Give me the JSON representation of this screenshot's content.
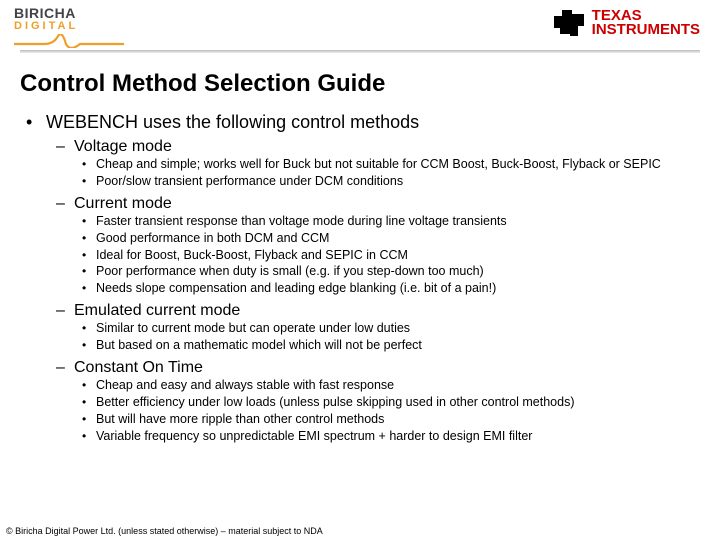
{
  "branding": {
    "left_top": "BIRICHA",
    "left_bottom": "DIGITAL",
    "right_line1": "TEXAS",
    "right_line2": "INSTRUMENTS"
  },
  "title": "Control Method Selection Guide",
  "main_bullet": "WEBENCH uses the following control methods",
  "sections": [
    {
      "heading": "Voltage mode",
      "points": [
        "Cheap and simple; works well for Buck but not suitable for CCM Boost, Buck-Boost, Flyback or SEPIC",
        "Poor/slow transient performance under DCM conditions"
      ]
    },
    {
      "heading": "Current mode",
      "points": [
        "Faster transient response than voltage mode during line voltage transients",
        "Good performance in both DCM and CCM",
        "Ideal for Boost, Buck-Boost, Flyback and SEPIC in CCM",
        "Poor performance when duty is small (e.g. if you step-down too much)",
        "Needs slope compensation and leading edge blanking (i.e. bit of a pain!)"
      ]
    },
    {
      "heading": "Emulated current mode",
      "points": [
        "Similar to current mode but can operate under low duties",
        "But based on a mathematic model which will not be perfect"
      ]
    },
    {
      "heading": "Constant On Time",
      "points": [
        "Cheap and easy and always stable with fast response",
        "Better efficiency under low loads (unless pulse skipping used in other control methods)",
        "But will have more ripple than other control methods",
        "Variable frequency so unpredictable EMI spectrum + harder to design EMI filter"
      ]
    }
  ],
  "footer": "© Biricha Digital Power Ltd. (unless stated otherwise) – material subject to NDA"
}
